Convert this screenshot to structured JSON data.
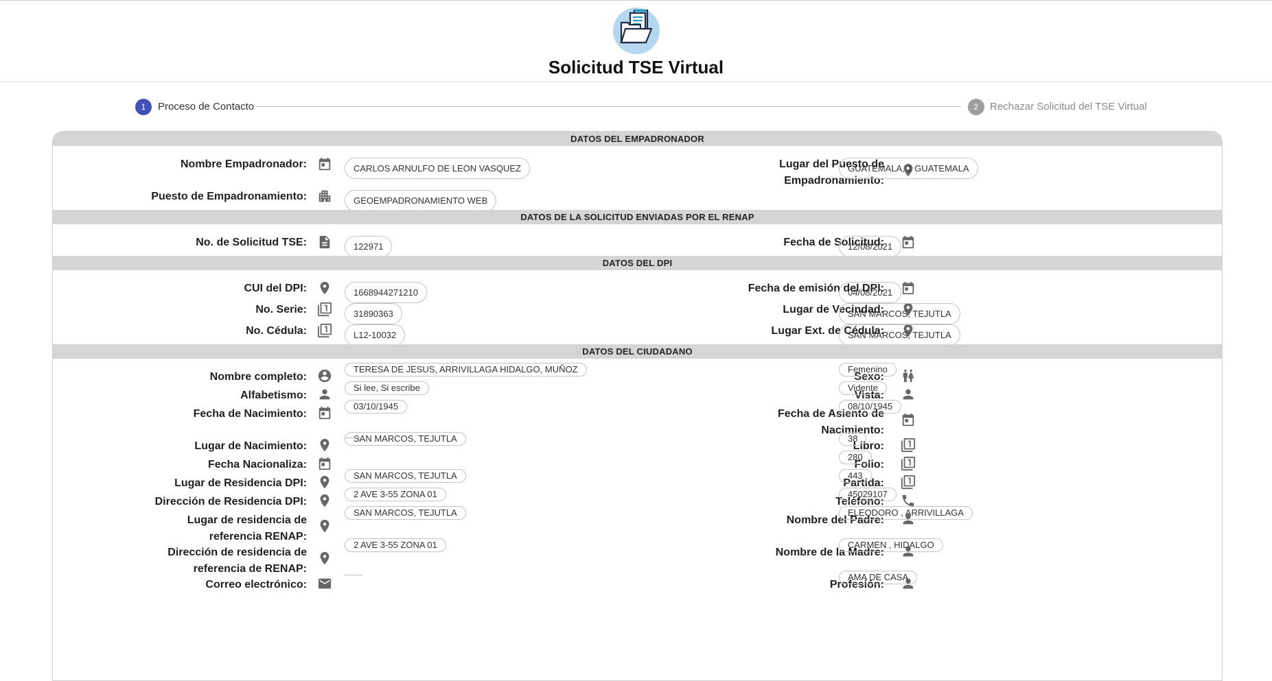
{
  "page_title": "Solicitud TSE Virtual",
  "stepper": [
    {
      "number": "1",
      "label": "Proceso de Contacto",
      "active": true
    },
    {
      "number": "2",
      "label": "Rechazar Solicitud del TSE Virtual",
      "active": false
    }
  ],
  "colors": {
    "active_step": "#3f51b5",
    "inactive_step": "#9e9e9e",
    "section_header": "#d5d5d5",
    "logo_bg": "#b5d8f0",
    "icon": "#666666"
  },
  "sections": {
    "empadronador": {
      "title": "DATOS DEL EMPADRONADOR",
      "fields": {
        "nombre": {
          "label": "Nombre Empadronador:",
          "value": "CARLOS ARNULFO DE LEON VASQUEZ",
          "icon": "calendar-icon"
        },
        "lugar_puesto": {
          "label": "Lugar del Puesto de Empadronamiento:",
          "value": "GUATEMALA, 1 GUATEMALA",
          "icon": "location-pin-icon"
        },
        "puesto": {
          "label": "Puesto de Empadronamiento:",
          "value": "GEOEMPADRONAMIENTO WEB",
          "icon": "building-icon"
        }
      }
    },
    "renap": {
      "title": "DATOS DE LA SOLICITUD ENVIADAS POR EL RENAP",
      "fields": {
        "no_solicitud": {
          "label": "No. de Solicitud TSE:",
          "value": "122971",
          "icon": "document-icon"
        },
        "fecha_solicitud": {
          "label": "Fecha de Solicitud:",
          "value": "12/08/2021",
          "icon": "calendar-icon"
        }
      }
    },
    "dpi": {
      "title": "DATOS DEL DPI",
      "fields": {
        "cui": {
          "label": "CUI del DPI:",
          "value": "1668944271210",
          "icon": "location-pin-icon"
        },
        "fecha_emision": {
          "label": "Fecha de emisión del DPI:",
          "value": "04/08/2021",
          "icon": "calendar-icon"
        },
        "no_serie": {
          "label": "No. Serie:",
          "value": "31890363",
          "icon": "filter-one-icon"
        },
        "lugar_vecindad": {
          "label": "Lugar de Vecindad:",
          "value": "SAN MARCOS, TEJUTLA",
          "icon": "location-pin-icon"
        },
        "no_cedula": {
          "label": "No. Cédula:",
          "value": "L12-10032",
          "icon": "filter-one-icon"
        },
        "lugar_ext_cedula": {
          "label": "Lugar Ext. de Cédula:",
          "value": "SAN MARCOS, TEJUTLA",
          "icon": "location-pin-icon"
        }
      }
    },
    "ciudadano": {
      "title": "DATOS DEL CIUDADANO",
      "fields": {
        "nombre_completo": {
          "label": "Nombre completo:",
          "value": "TERESA DE JESUS, ARRIVILLAGA HIDALGO, MUÑOZ",
          "icon": "account-circle-icon"
        },
        "sexo": {
          "label": "Sexo:",
          "value": "Femenino",
          "icon": "people-icon"
        },
        "alfabetismo": {
          "label": "Alfabetismo:",
          "value": "Si lee, Si escribe",
          "icon": "person-icon"
        },
        "vista": {
          "label": "Vista:",
          "value": "Vidente",
          "icon": "person-icon"
        },
        "fecha_nacimiento": {
          "label": "Fecha de Nacimiento:",
          "value": "03/10/1945",
          "icon": "calendar-icon"
        },
        "fecha_asiento": {
          "label": "Fecha de Asiento de Nacimiento:",
          "value": "08/10/1945",
          "icon": "calendar-icon"
        },
        "lugar_nacimiento": {
          "label": "Lugar de Nacimiento:",
          "value": "SAN MARCOS, TEJUTLA",
          "icon": "location-pin-icon"
        },
        "libro": {
          "label": "Libro:",
          "value": "38",
          "icon": "filter-one-icon"
        },
        "fecha_nacionaliza": {
          "label": "Fecha Nacionaliza:",
          "value": "",
          "icon": "calendar-icon"
        },
        "folio": {
          "label": "Folio:",
          "value": "280",
          "icon": "filter-one-icon"
        },
        "lugar_residencia_dpi": {
          "label": "Lugar de Residencia DPI:",
          "value": "SAN MARCOS, TEJUTLA",
          "icon": "location-pin-icon"
        },
        "partida": {
          "label": "Partida:",
          "value": "443",
          "icon": "filter-one-icon"
        },
        "direccion_residencia_dpi": {
          "label": "Dirección de Residencia DPI:",
          "value": "2 AVE 3-55 ZONA 01",
          "icon": "location-pin-icon"
        },
        "telefono": {
          "label": "Teléfono:",
          "value": "45029107",
          "icon": "phone-icon"
        },
        "lugar_residencia_renap": {
          "label": "Lugar de residencia de referencia RENAP:",
          "value": "SAN MARCOS, TEJUTLA",
          "icon": "location-pin-icon"
        },
        "nombre_padre": {
          "label": "Nombre del Padre:",
          "value": "ELEODORO , ARRIVILLAGA",
          "icon": "person-icon"
        },
        "direccion_residencia_renap": {
          "label": "Dirección de residencia de referencia de RENAP:",
          "value": "2 AVE 3-55 ZONA 01",
          "icon": "location-pin-icon"
        },
        "nombre_madre": {
          "label": "Nombre de la Madre:",
          "value": "CARMEN , HIDALGO",
          "icon": "person-icon"
        },
        "correo": {
          "label": "Correo electrónico:",
          "value": "",
          "icon": "mail-icon"
        },
        "profesion": {
          "label": "Profesión:",
          "value": "AMA DE CASA",
          "icon": "person-icon"
        }
      }
    }
  }
}
